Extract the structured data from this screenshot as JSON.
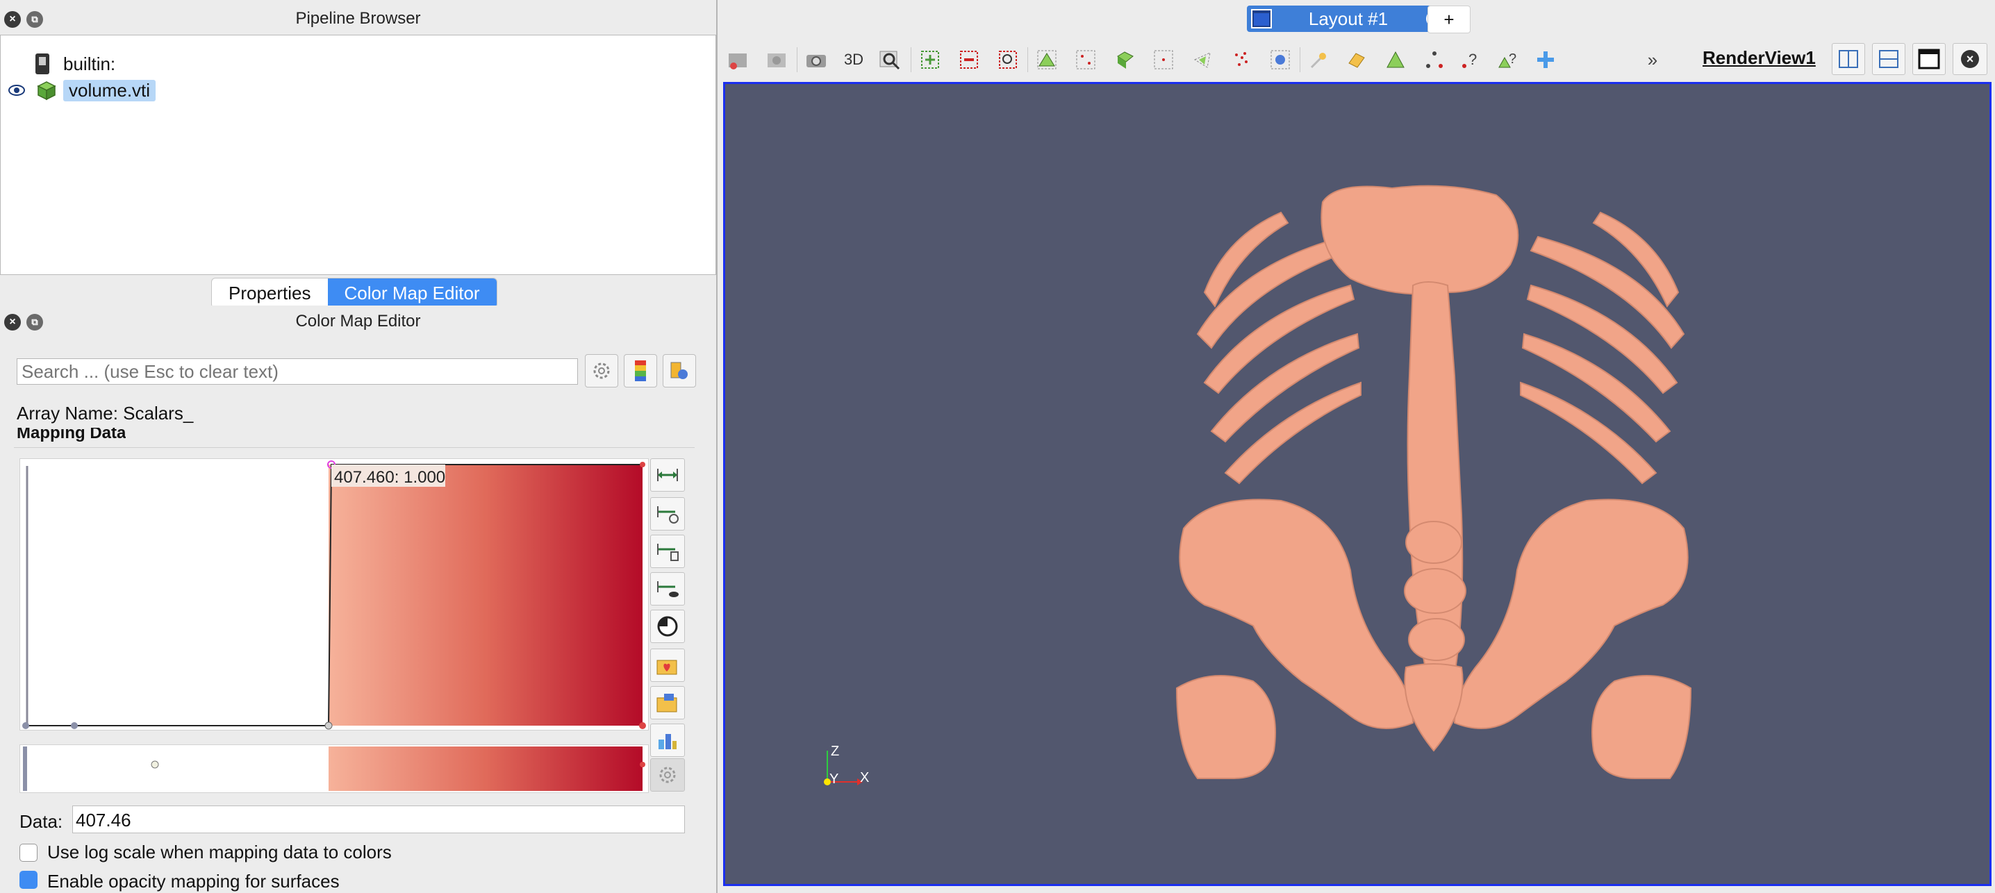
{
  "pipeline_browser": {
    "title": "Pipeline Browser",
    "items": [
      {
        "label": "builtin:"
      },
      {
        "label": "volume.vti"
      }
    ]
  },
  "tabs": [
    {
      "label": "Properties"
    },
    {
      "label": "Color Map Editor"
    }
  ],
  "color_map_editor": {
    "title": "Color Map Editor",
    "search_placeholder": "Search ... (use Esc to clear text)",
    "array_name": "Array Name: Scalars_",
    "mapping_data_label": "Mapping Data",
    "point_tooltip": "407.460: 1.000",
    "data_label": "Data:",
    "data_value": "407.46",
    "log_scale_label": "Use log scale when mapping data to colors",
    "opacity_label": "Enable opacity mapping for surfaces"
  },
  "layout": {
    "tab_label": "Layout #1",
    "add_label": "+"
  },
  "toolbar": {
    "label_3d": "3D",
    "render_view_label": "RenderView1"
  },
  "render_view": {
    "axes": {
      "z": "Z",
      "y": "Y",
      "x": "X"
    }
  },
  "colors": {
    "render_background": "#52576e",
    "bone": "#f1a488",
    "accent": "#3e8cf3",
    "colormap_low": "#f6b29a",
    "colormap_high": "#b40b28"
  }
}
